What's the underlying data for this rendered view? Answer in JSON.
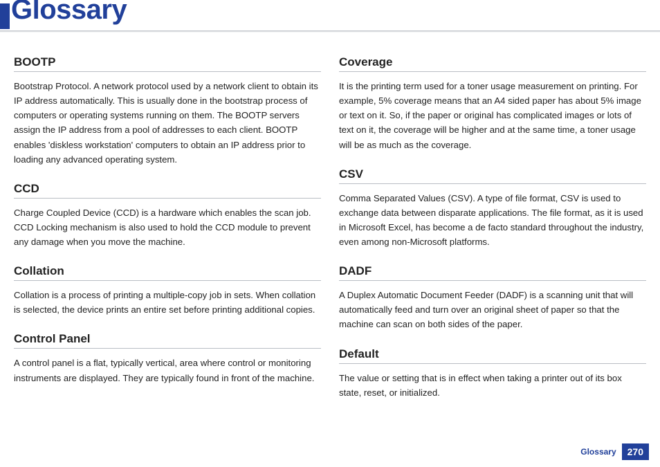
{
  "header": {
    "title": "Glossary"
  },
  "left": [
    {
      "term": "BOOTP",
      "def": "Bootstrap Protocol. A network protocol used by a network client to obtain its IP address automatically. This is usually done in the bootstrap process of computers or operating systems running on them. The BOOTP servers assign the IP address from a pool of addresses to each client. BOOTP enables 'diskless workstation' computers to obtain an IP address prior to loading any advanced operating system."
    },
    {
      "term": "CCD",
      "def": "Charge Coupled Device (CCD) is a hardware which enables the scan job. CCD Locking mechanism is also used to hold the CCD module to prevent any damage when you move the machine."
    },
    {
      "term": "Collation",
      "def": "Collation is a process of printing a multiple-copy job in sets. When collation is selected, the device prints an entire set before printing additional copies."
    },
    {
      "term": "Control Panel",
      "def": "A control panel is a flat, typically vertical, area where control or monitoring instruments are displayed. They are typically found in front of the machine."
    }
  ],
  "right": [
    {
      "term": "Coverage",
      "def": "It is the printing term used for a toner usage measurement on printing. For example, 5% coverage means that an A4 sided paper has about 5% image or text on it. So, if the paper or original has complicated images or lots of text on it, the coverage will be higher and at the same time, a toner usage will be as much as the coverage."
    },
    {
      "term": "CSV",
      "def": "Comma Separated Values (CSV). A type of file format, CSV is used to exchange data between disparate applications. The file format, as it is used in Microsoft Excel, has become a de facto standard throughout the industry, even among non-Microsoft platforms."
    },
    {
      "term": "DADF",
      "def": "A Duplex Automatic Document Feeder (DADF) is a scanning unit that will automatically feed and turn over an original sheet of paper so that the machine can scan on both sides of the paper."
    },
    {
      "term": "Default",
      "def": "The value or setting that is in effect when taking a printer out of its box state, reset, or initialized."
    }
  ],
  "footer": {
    "section": "Glossary",
    "page": "270"
  }
}
